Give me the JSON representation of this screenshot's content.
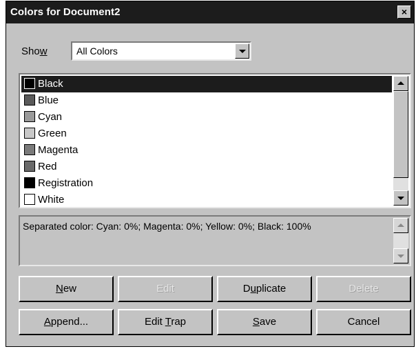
{
  "window": {
    "title": "Colors for Document2",
    "close_glyph": "×"
  },
  "show": {
    "label_pre": "Sho",
    "label_u": "w",
    "value": "All Colors"
  },
  "colors": [
    {
      "label": "Black",
      "swatch": "#000000",
      "selected": true
    },
    {
      "label": "Blue",
      "swatch": "#5a5a5a",
      "selected": false
    },
    {
      "label": "Cyan",
      "swatch": "#9a9a9a",
      "selected": false
    },
    {
      "label": "Green",
      "swatch": "#c8c8c8",
      "selected": false
    },
    {
      "label": "Magenta",
      "swatch": "#7a7a7a",
      "selected": false
    },
    {
      "label": "Red",
      "swatch": "#6a6a6a",
      "selected": false
    },
    {
      "label": "Registration",
      "swatch": "#000000",
      "selected": false
    },
    {
      "label": "White",
      "swatch": "#ffffff",
      "selected": false
    }
  ],
  "description": "Separated color: Cyan: 0%; Magenta: 0%; Yellow: 0%; Black: 100%",
  "buttons": {
    "new": {
      "u": "N",
      "rest": "ew"
    },
    "edit": {
      "text": "Edit"
    },
    "duplicate": {
      "pre": "D",
      "u": "u",
      "rest": "plicate"
    },
    "delete": {
      "text": "Delete"
    },
    "append": {
      "u": "A",
      "rest": "ppend..."
    },
    "edit_trap": {
      "pre": "Edit ",
      "u": "T",
      "rest": "rap"
    },
    "save": {
      "u": "S",
      "rest": "ave"
    },
    "cancel": {
      "text": "Cancel"
    }
  },
  "icons": {
    "close": "close-icon",
    "dropdown": "chevron-down-icon",
    "scroll_up": "scroll-up-arrow-icon",
    "scroll_down": "scroll-down-arrow-icon"
  }
}
